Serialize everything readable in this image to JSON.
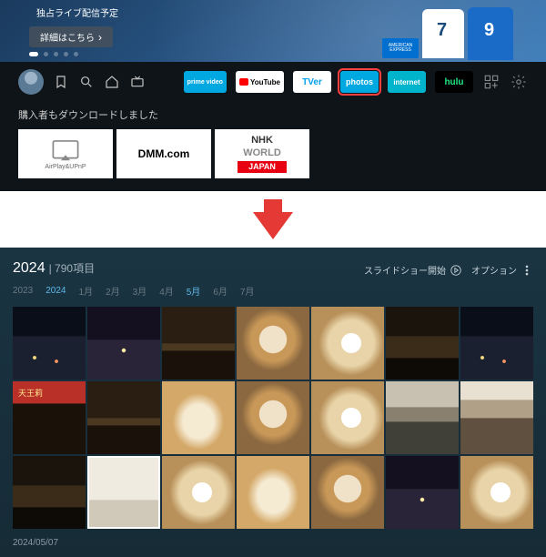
{
  "hero": {
    "badge": "独占ライブ配信予定",
    "button": "詳細はこちら",
    "amex": "AMERICAN EXPRESS"
  },
  "nav": {
    "apps": {
      "prime": "prime video",
      "youtube": "YouTube",
      "tver": "TVer",
      "photos": "photos",
      "internet": "internet",
      "hulu": "hulu"
    }
  },
  "downloads": {
    "label": "購入者もダウンロードしました",
    "airplay": "AirPlay&UPnP",
    "dmm": "DMM.com",
    "nhk1": "NHK",
    "nhk2": "WORLD",
    "nhk3": "JAPAN"
  },
  "photosApp": {
    "year": "2024",
    "count": "790項目",
    "slideshow": "スライドショー開始",
    "options": "オプション",
    "filters": {
      "y2023": "2023",
      "y2024": "2024",
      "m1": "1月",
      "m2": "2月",
      "m3": "3月",
      "m4": "4月",
      "m5": "5月",
      "m6": "6月",
      "m7": "7月"
    },
    "date": "2024/05/07"
  }
}
